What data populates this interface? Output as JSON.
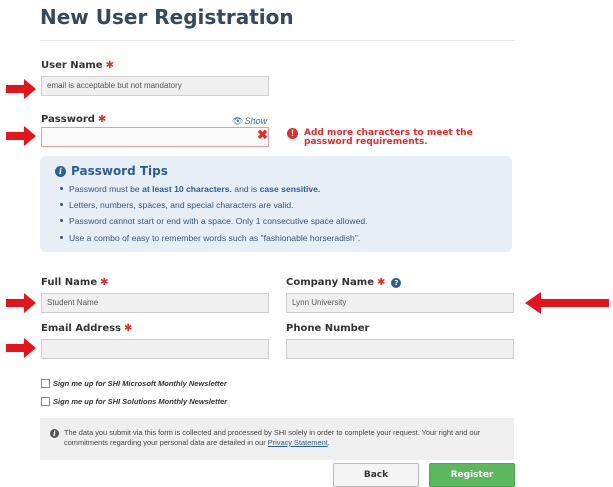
{
  "page": {
    "title": "New User Registration"
  },
  "required_marker": "✱",
  "username": {
    "label": "User Name",
    "value": "email is acceptable but not mandatory"
  },
  "password": {
    "label": "Password",
    "value": "",
    "show_label": "Show",
    "error": "Add more characters to meet the password requirements."
  },
  "tips": {
    "title": "Password Tips",
    "t1_pre": "Password must be ",
    "t1_b1": "at least 10 characters.",
    "t1_mid": " and is ",
    "t1_b2": "case sensitive.",
    "t2": "Letters, numbers, spaces, and special characters are valid.",
    "t3": "Password cannot start or end with a space. Only 1 consecutive space allowed.",
    "t4": "Use a combo of easy to remember words such as \"fashionable horseradish\"."
  },
  "fullname": {
    "label": "Full Name",
    "value": "Student Name"
  },
  "company": {
    "label": "Company Name",
    "value": "Lynn University"
  },
  "email": {
    "label": "Email Address",
    "value": ""
  },
  "phone": {
    "label": "Phone Number",
    "value": ""
  },
  "newsletters": {
    "microsoft": "Sign me up for SHI Microsoft Monthly Newsletter",
    "solutions": "Sign me up for SHI Solutions Monthly Newsletter"
  },
  "privacy": {
    "text": "The data you submit via this form is collected and processed by SHI solely in order to complete your request. Your right and our commitments regarding your personal data are detailed in our ",
    "link": "Privacy Statement",
    "end": "."
  },
  "buttons": {
    "back": "Back",
    "register": "Register"
  },
  "colors": {
    "arrow": "#e3141b",
    "required": "#e32b2b",
    "primary": "#2c5f93",
    "register": "#5cb85c"
  },
  "icons": {
    "annotation": "red-arrow-icon",
    "show": "eye-icon",
    "clear": "close-icon",
    "error": "exclamation-icon",
    "tips": "info-icon",
    "help": "question-icon"
  }
}
